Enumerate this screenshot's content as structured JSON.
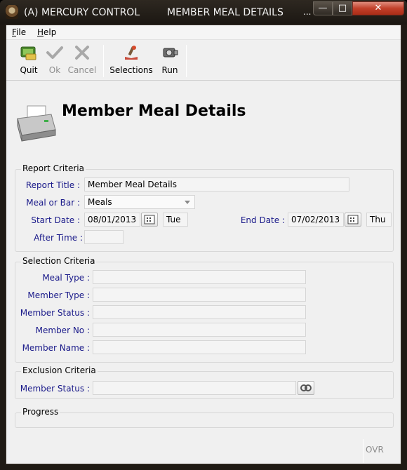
{
  "window": {
    "app_title": "(A) MERCURY CONTROL",
    "form_title": "MEMBER MEAL DETAILS",
    "overflow_marker": "...",
    "minimize_glyph": "—",
    "maximize_glyph": "□",
    "close_glyph": "✕"
  },
  "menu": {
    "items": [
      "File",
      "Help"
    ]
  },
  "toolbar": {
    "quit": "Quit",
    "ok": "Ok",
    "cancel": "Cancel",
    "selections": "Selections",
    "run": "Run"
  },
  "header": {
    "title": "Member Meal Details",
    "icon": "printer-icon"
  },
  "report_criteria": {
    "title": "Report Criteria",
    "report_title_label": "Report Title :",
    "report_title_value": "Member Meal Details",
    "meal_or_bar_label": "Meal or Bar :",
    "meal_or_bar_value": "Meals",
    "start_date_label": "Start Date :",
    "start_date_value": "08/01/2013",
    "start_day": "Tue",
    "end_date_label": "End Date :",
    "end_date_value": "07/02/2013",
    "end_day": "Thu",
    "after_time_label": "After Time :",
    "after_time_value": ""
  },
  "selection_criteria": {
    "title": "Selection Criteria",
    "meal_type_label": "Meal Type :",
    "member_type_label": "Member Type :",
    "member_status_label": "Member Status :",
    "member_no_label": "Member No :",
    "member_name_label": "Member Name :"
  },
  "exclusion_criteria": {
    "title": "Exclusion Criteria",
    "member_status_label": "Member Status :",
    "member_status_value": ""
  },
  "progress": {
    "title": "Progress"
  },
  "status": {
    "ovr": "OVR"
  },
  "colors": {
    "label_blue": "#1a1a8a",
    "close_red": "#c2402a"
  }
}
